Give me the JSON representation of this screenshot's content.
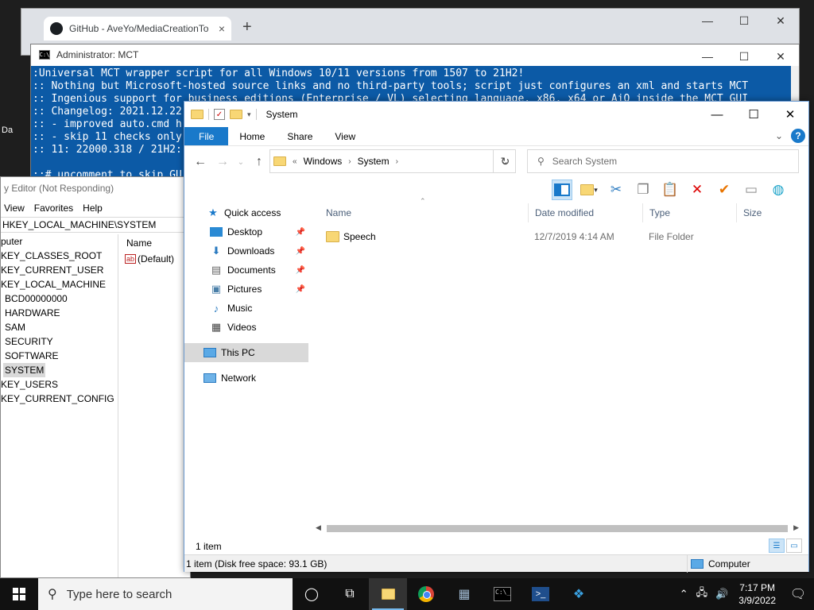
{
  "desktop": {
    "icon_label": "Da"
  },
  "browser": {
    "tab_title": "GitHub - AveYo/MediaCreationTo",
    "tab_close": "×",
    "new_tab": "+",
    "controls": {
      "minimize": "—",
      "maximize": "☐",
      "close": "✕"
    }
  },
  "console": {
    "title": "Administrator:  MCT",
    "icon_text": "C:\\",
    "lines": [
      ":Universal MCT wrapper script for all Windows 10/11 versions from 1507 to 21H2!",
      ":: Nothing but Microsoft-hosted source links and no third-party tools; script just configures an xml and starts MCT",
      ":: Ingenious support for business editions (Enterprise / VL) selecting language, x86, x64 or AiO inside the MCT GUI",
      ":: Changelog: 2021.12.22",
      ":: - improved auto.cmd h",
      ":: - skip 11 checks only",
      ":: 11: 22000.318 / 21H2:",
      "",
      "::# uncomment to skip GU"
    ],
    "controls": {
      "minimize": "—",
      "maximize": "☐",
      "close": "✕"
    }
  },
  "regedit": {
    "title": "y Editor (Not Responding)",
    "menu": [
      "View",
      "Favorites",
      "Help"
    ],
    "address": "HKEY_LOCAL_MACHINE\\SYSTEM",
    "tree": [
      "puter",
      "KEY_CLASSES_ROOT",
      "KEY_CURRENT_USER",
      "KEY_LOCAL_MACHINE",
      "BCD00000000",
      "HARDWARE",
      "SAM",
      "SECURITY",
      "SOFTWARE",
      "SYSTEM",
      "KEY_USERS",
      "KEY_CURRENT_CONFIG"
    ],
    "values_header": "Name",
    "value_item": "(Default)",
    "value_icon": "ab"
  },
  "explorer": {
    "title": "System",
    "controls": {
      "minimize": "—",
      "maximize": "☐",
      "close": "✕"
    },
    "ribbon_tabs": {
      "file": "File",
      "home": "Home",
      "share": "Share",
      "view": "View"
    },
    "ribbon_expand": "⌄",
    "help": "?",
    "breadcrumb": {
      "prefix": "«",
      "part1": "Windows",
      "part2": "System"
    },
    "search_placeholder": "Search System",
    "nav": {
      "quick_access": "Quick access",
      "desktop": "Desktop",
      "downloads": "Downloads",
      "documents": "Documents",
      "pictures": "Pictures",
      "music": "Music",
      "videos": "Videos",
      "this_pc": "This PC",
      "network": "Network"
    },
    "columns": {
      "name": "Name",
      "date": "Date modified",
      "type": "Type",
      "size": "Size"
    },
    "files": [
      {
        "name": "Speech",
        "date": "12/7/2019 4:14 AM",
        "type": "File Folder"
      }
    ],
    "item_count": "1 item",
    "details": "1 item (Disk free space: 93.1 GB)",
    "location": "Computer"
  },
  "taskbar": {
    "search_placeholder": "Type here to search",
    "time": "7:17 PM",
    "date": "3/9/2022",
    "ps_label": ">_",
    "cmd_label": "C:\\_"
  }
}
